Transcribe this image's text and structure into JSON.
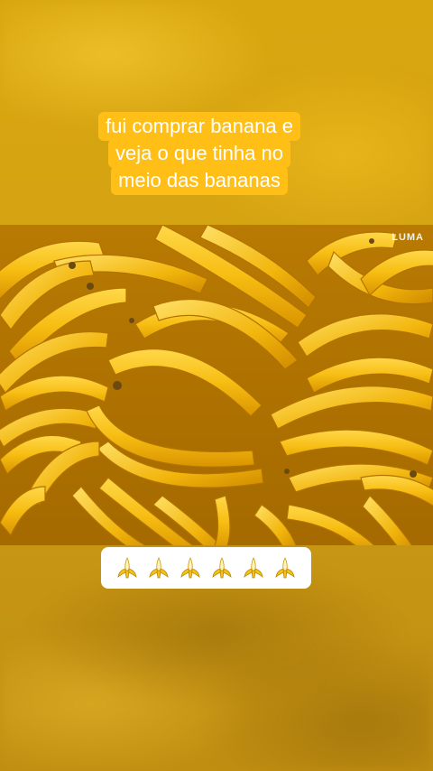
{
  "caption": {
    "lines": [
      "fui comprar banana e",
      "veja o que tinha no",
      "meio das bananas"
    ]
  },
  "photo": {
    "watermark": "LUMA"
  },
  "emoji_bar": {
    "icons": [
      "banana-peeled-icon",
      "banana-peeled-icon",
      "banana-peeled-icon",
      "banana-peeled-icon",
      "banana-peeled-icon",
      "banana-peeled-icon"
    ]
  },
  "colors": {
    "caption_bg": "#ffbf16",
    "caption_text": "#ffffff",
    "background": "#d6a312"
  }
}
